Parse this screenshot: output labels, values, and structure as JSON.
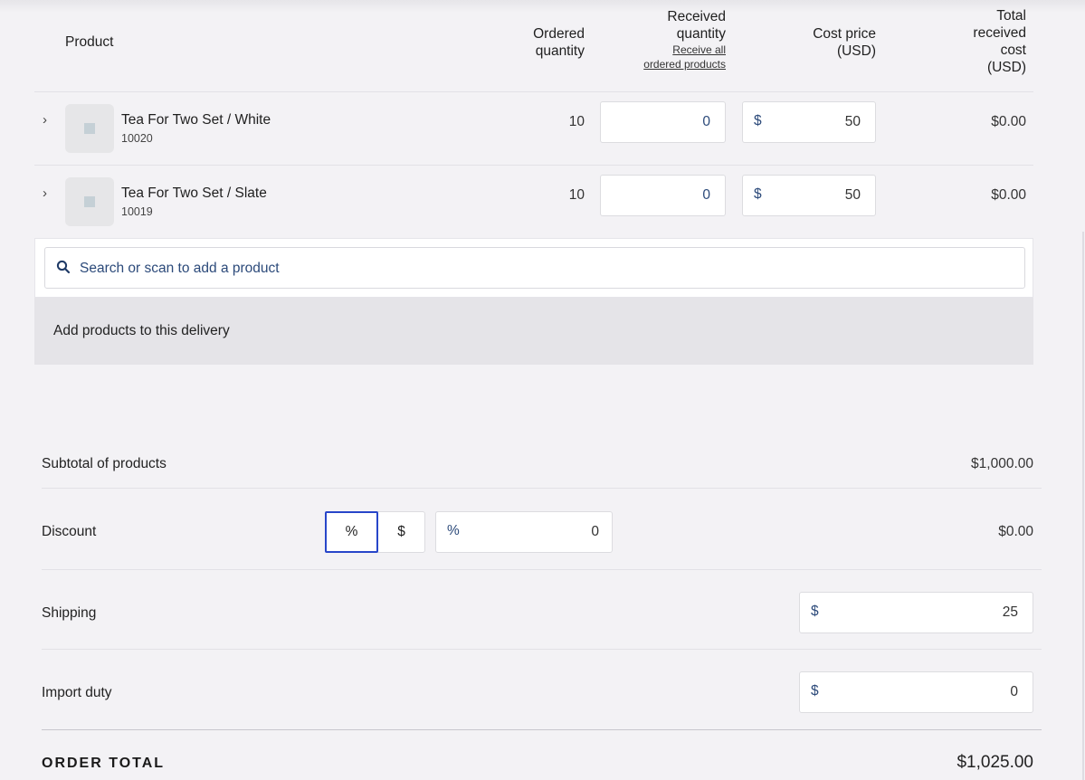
{
  "table": {
    "headers": {
      "product": "Product",
      "ordered_quantity": [
        "Ordered",
        "quantity"
      ],
      "received_quantity": [
        "Received",
        "quantity"
      ],
      "receive_all_link": [
        "Receive all",
        "ordered products"
      ],
      "cost_price": [
        "Cost price",
        "(USD)"
      ],
      "total_received_cost": [
        "Total",
        "received",
        "cost",
        "(USD)"
      ]
    },
    "rows": [
      {
        "name": "Tea For Two Set / White",
        "sku": "10020",
        "ordered": "10",
        "received": "0",
        "currency_symbol": "$",
        "cost_price": "50",
        "total": "$0.00"
      },
      {
        "name": "Tea For Two Set / Slate",
        "sku": "10019",
        "ordered": "10",
        "received": "0",
        "currency_symbol": "$",
        "cost_price": "50",
        "total": "$0.00"
      }
    ]
  },
  "search": {
    "placeholder": "Search or scan to add a product",
    "add_products_label": "Add products to this delivery"
  },
  "totals": {
    "subtotal_label": "Subtotal of products",
    "subtotal_value": "$1,000.00",
    "discount_label": "Discount",
    "discount_toggle_percent": "%",
    "discount_toggle_dollar": "$",
    "discount_input_prefix": "%",
    "discount_input_value": "0",
    "discount_value": "$0.00",
    "shipping_label": "Shipping",
    "shipping_prefix": "$",
    "shipping_value": "25",
    "import_duty_label": "Import duty",
    "import_duty_prefix": "$",
    "import_duty_value": "0",
    "order_total_label": "ORDER TOTAL",
    "order_total_value": "$1,025.00"
  },
  "colors": {
    "accent_blue": "#2846c9",
    "link_navy": "#2c4a7a",
    "background": "#f3f2f5"
  }
}
